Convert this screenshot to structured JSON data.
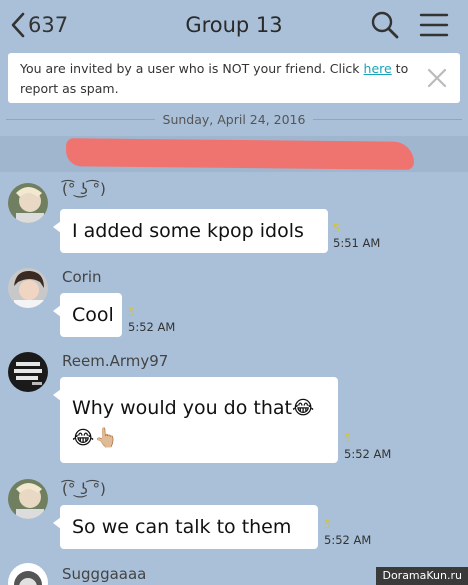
{
  "header": {
    "back_label": "637",
    "title": "Group 13"
  },
  "notice": {
    "text_before": "You are invited by a user who is NOT your friend. Click ",
    "link_text": "here",
    "text_after": " to report as spam."
  },
  "date_separator": "Sunday, April 24, 2016",
  "messages": [
    {
      "sender": "(͡° ͜ʖ ͡°)",
      "text": "I added some kpop idols",
      "read": "5",
      "time": "5:51 AM"
    },
    {
      "sender": "Corin",
      "text": "Cool",
      "read": "5",
      "time": "5:52 AM"
    },
    {
      "sender": "Reem.Army97",
      "text": "Why would you do that😂",
      "text2": "😂👆🏼",
      "read": "5",
      "time": "5:52 AM"
    },
    {
      "sender": "(͡° ͜ʖ ͡°)",
      "text": "So we can talk to them",
      "read": "5",
      "time": "5:52 AM"
    },
    {
      "sender": "Sugggaaaa"
    }
  ],
  "watermark": "DoramaKun.ru",
  "colors": {
    "background": "#a9c0d8",
    "link": "#1aa3b8",
    "read_count": "#d4c23a",
    "redaction": "#ef7470"
  }
}
